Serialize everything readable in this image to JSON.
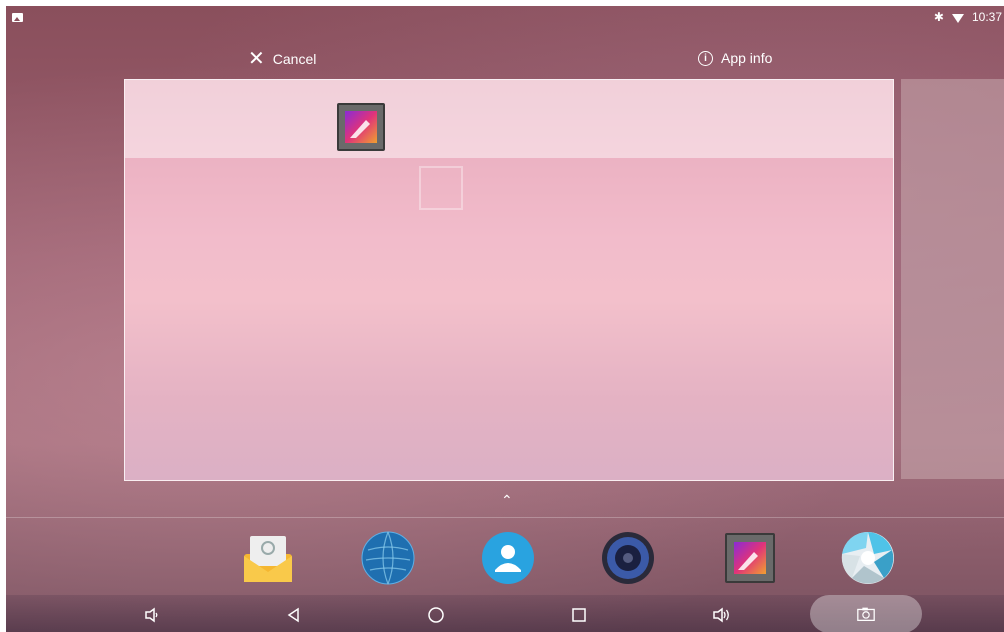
{
  "status_bar": {
    "time": "10:37",
    "bluetooth_icon": "bluetooth-icon",
    "wifi_icon": "wifi-icon",
    "notification_icon": "gallery-notification-icon"
  },
  "drop_targets": {
    "cancel_label": "Cancel",
    "app_info_label": "App info"
  },
  "workspace": {
    "dragged_app_icon": "gallery-icon"
  },
  "hotseat": {
    "apps": [
      {
        "name": "email",
        "icon": "email-icon"
      },
      {
        "name": "browser",
        "icon": "globe-icon"
      },
      {
        "name": "contacts",
        "icon": "contacts-icon"
      },
      {
        "name": "music",
        "icon": "speaker-icon"
      },
      {
        "name": "gallery",
        "icon": "gallery-icon"
      },
      {
        "name": "camera",
        "icon": "camera-shutter-icon"
      }
    ]
  },
  "navbar": {
    "buttons": [
      "volume-down-icon",
      "back-icon",
      "home-icon",
      "recents-icon",
      "volume-up-icon",
      "screenshot-icon"
    ]
  },
  "colors": {
    "accent_blue": "#29a3e0",
    "email_yellow": "#f5b731"
  }
}
